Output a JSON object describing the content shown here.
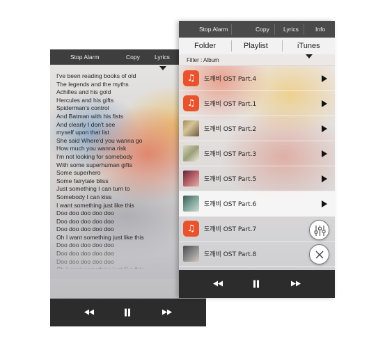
{
  "lyrics_screen": {
    "menu": {
      "stop_alarm": "Stop Alarm",
      "copy": "Copy",
      "lyrics": "Lyrics"
    },
    "lyrics_lines": [
      "I've been reading books of old",
      "The legends and the myths",
      "Achilles and his gold",
      "Hercules and his gifts",
      "Spiderman's control",
      "And Batman with his fists",
      "And clearly I don't see",
      "myself upon that list",
      "She said Where'd you wanna go",
      "How much you wanna risk",
      "I'm not looking for somebody",
      "With some superhuman gifts",
      "Some superhero",
      "Some fairytale bliss",
      "Just something I can turn to",
      "Somebody I can kiss",
      "I want something just like this",
      "Doo doo doo doo doo",
      "Doo doo doo doo doo",
      "Doo doo doo doo doo",
      "Oh I want something just like this",
      "Doo doo doo doo doo",
      "Doo doo doo doo doo",
      "Doo doo doo doo doo",
      "Oh I want something just like this"
    ]
  },
  "playlist_screen": {
    "menu": {
      "stop_alarm": "Stop Alarm",
      "copy": "Copy",
      "lyrics": "Lyrics",
      "info": "Info"
    },
    "tabs": {
      "folder": "Folder",
      "playlist": "Playlist",
      "itunes": "iTunes"
    },
    "filter_label": "Filter : Album",
    "tracks": [
      {
        "title": "도깨비 OST Part.4",
        "thumb": "music-app-icon"
      },
      {
        "title": "도깨비 OST Part.1",
        "thumb": "music-app-icon"
      },
      {
        "title": "도깨비 OST Part.2",
        "thumb": "album-art"
      },
      {
        "title": "도깨비 OST Part.3",
        "thumb": "album-art"
      },
      {
        "title": "도깨비 OST Part.5",
        "thumb": "album-art"
      },
      {
        "title": "도깨비 OST Part.6",
        "thumb": "album-art"
      },
      {
        "title": "도깨비 OST Part.7",
        "thumb": "music-app-icon"
      },
      {
        "title": "도깨비 OST Part.8",
        "thumb": "album-art"
      }
    ],
    "selected_track_index": 5
  },
  "colors": {
    "menu_bar": "#4a4a4a",
    "control_bar": "#2c2c2c",
    "app_icon": "#e8532e"
  }
}
